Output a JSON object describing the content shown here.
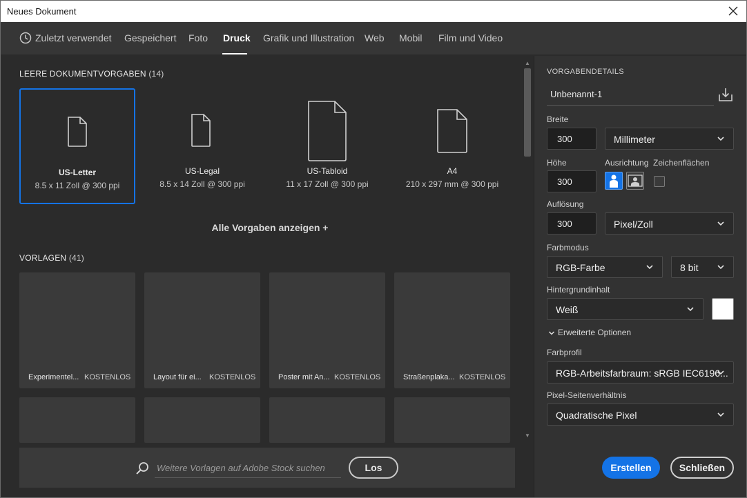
{
  "window": {
    "title": "Neues Dokument"
  },
  "tabs": [
    {
      "label": "Zuletzt verwendet"
    },
    {
      "label": "Gespeichert"
    },
    {
      "label": "Foto"
    },
    {
      "label": "Druck",
      "active": true
    },
    {
      "label": "Grafik und Illustration"
    },
    {
      "label": "Web"
    },
    {
      "label": "Mobil"
    },
    {
      "label": "Film und Video"
    }
  ],
  "presets_section": {
    "title": "LEERE DOKUMENTVORGABEN",
    "count": "(14)"
  },
  "presets": [
    {
      "name": "US-Letter",
      "size": "8.5 x 11 Zoll @ 300 ppi",
      "selected": true
    },
    {
      "name": "US-Legal",
      "size": "8.5 x 14 Zoll @ 300 ppi"
    },
    {
      "name": "US-Tabloid",
      "size": "11 x 17 Zoll @ 300 ppi"
    },
    {
      "name": "A4",
      "size": "210 x 297 mm @ 300 ppi"
    }
  ],
  "show_all_label": "Alle Vorgaben anzeigen +",
  "templates_section": {
    "title": "VORLAGEN",
    "count": "(41)"
  },
  "templates": [
    {
      "name": "Experimentel...",
      "badge": "KOSTENLOS"
    },
    {
      "name": "Layout für ei...",
      "badge": "KOSTENLOS"
    },
    {
      "name": "Poster mit An...",
      "badge": "KOSTENLOS"
    },
    {
      "name": "Straßenplaka...",
      "badge": "KOSTENLOS"
    }
  ],
  "search": {
    "placeholder": "Weitere Vorlagen auf Adobe Stock suchen",
    "button_label": "Los"
  },
  "details": {
    "title": "VORGABENDETAILS",
    "doc_name": "Unbenannt-1",
    "width_label": "Breite",
    "width_value": "300",
    "width_unit": "Millimeter",
    "height_label": "Höhe",
    "height_value": "300",
    "orientation_label": "Ausrichtung",
    "artboards_label": "Zeichenflächen",
    "resolution_label": "Auflösung",
    "resolution_value": "300",
    "resolution_unit": "Pixel/Zoll",
    "color_mode_label": "Farbmodus",
    "color_mode": "RGB-Farbe",
    "bit_depth": "8 bit",
    "background_label": "Hintergrundinhalt",
    "background": "Weiß",
    "background_color": "#ffffff",
    "advanced_label": "Erweiterte Optionen",
    "color_profile_label": "Farbprofil",
    "color_profile": "RGB-Arbeitsfarbraum: sRGB IEC6196...",
    "pixel_aspect_label": "Pixel-Seitenverhältnis",
    "pixel_aspect": "Quadratische Pixel"
  },
  "buttons": {
    "create": "Erstellen",
    "close": "Schließen"
  },
  "colors": {
    "accent": "#1473e6",
    "panel": "#323232",
    "background": "#2b2b2b"
  }
}
